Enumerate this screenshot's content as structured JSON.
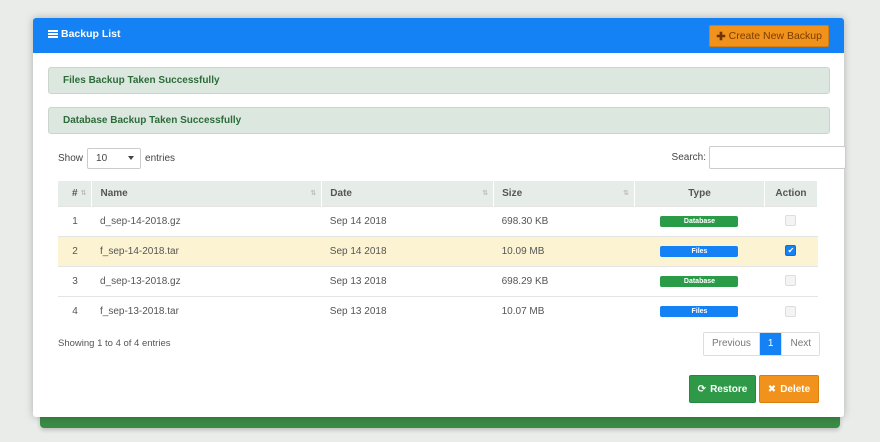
{
  "header": {
    "title": "Backup List",
    "create_button": "Create New Backup"
  },
  "alerts": {
    "files": "Files Backup Taken Successfully",
    "database": "Database Backup Taken Successfully"
  },
  "controls": {
    "show_label": "Show",
    "entries_value": "10",
    "entries_label": "entries",
    "search_label": "Search:",
    "search_value": ""
  },
  "table": {
    "columns": [
      "#",
      "Name",
      "Date",
      "Size",
      "Type",
      "Action"
    ],
    "rows": [
      {
        "num": "1",
        "name": "d_sep-14-2018.gz",
        "date": "Sep 14 2018",
        "size": "698.30 KB",
        "type": "Database",
        "selected": false
      },
      {
        "num": "2",
        "name": "f_sep-14-2018.tar",
        "date": "Sep 14 2018",
        "size": "10.09 MB",
        "type": "Files",
        "selected": true
      },
      {
        "num": "3",
        "name": "d_sep-13-2018.gz",
        "date": "Sep 13 2018",
        "size": "698.29 KB",
        "type": "Database",
        "selected": false
      },
      {
        "num": "4",
        "name": "f_sep-13-2018.tar",
        "date": "Sep 13 2018",
        "size": "10.07 MB",
        "type": "Files",
        "selected": false
      }
    ]
  },
  "footer": {
    "info": "Showing 1 to 4 of 4 entries",
    "previous": "Previous",
    "page": "1",
    "next": "Next",
    "restore_button": "Restore",
    "delete_button": "Delete"
  },
  "colors": {
    "primary": "#1482f5",
    "success": "#2e9a48",
    "warning": "#f0921b"
  },
  "icons": {
    "title": "list-icon",
    "create": "plus-icon",
    "restore": "refresh-icon",
    "delete": "close-icon"
  }
}
